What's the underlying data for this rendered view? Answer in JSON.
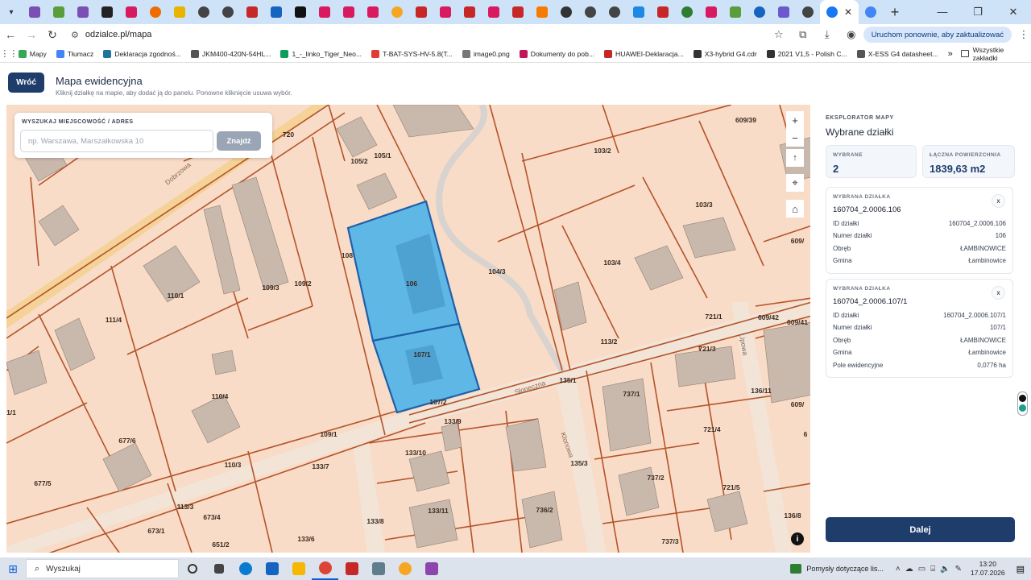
{
  "browser": {
    "url": "odzialce.pl/mapa",
    "update_label": "Uruchom ponownie, aby zaktualizować",
    "bookmarks": [
      {
        "label": "Mapy",
        "color": "#34a853"
      },
      {
        "label": "Tłumacz",
        "color": "#4285f4"
      },
      {
        "label": "Deklaracja zgodnoś...",
        "color": "#21759b"
      },
      {
        "label": "JKM400-420N-54HL...",
        "color": "#555555"
      },
      {
        "label": "1_-_linko_Tiger_Neo...",
        "color": "#0f9d58"
      },
      {
        "label": "T-BAT-SYS-HV-5.8(T...",
        "color": "#e53935"
      },
      {
        "label": "image0.png",
        "color": "#777777"
      },
      {
        "label": "Dokumenty do pob...",
        "color": "#c2185b"
      },
      {
        "label": "HUAWEI-Deklaracja...",
        "color": "#c62828"
      },
      {
        "label": "X3-hybrid G4.cdr",
        "color": "#333333"
      },
      {
        "label": "2021 V1,5 - Polish C...",
        "color": "#333333"
      },
      {
        "label": "X-ESS G4 datasheet...",
        "color": "#555555"
      }
    ],
    "all_bookmarks_label": "Wszystkie zakładki"
  },
  "header": {
    "back_label": "Wróć",
    "title": "Mapa ewidencyjna",
    "subtitle": "Kliknij działkę na mapie, aby dodać ją do panelu. Ponowne kliknięcie usuwa wybór."
  },
  "search": {
    "label": "WYSZUKAJ MIEJSCOWOŚĆ / ADRES",
    "placeholder": "np. Warszawa, Marszałkowska 10",
    "button": "Znajdź"
  },
  "map": {
    "parcel_labels": [
      {
        "text": "720"
      },
      {
        "text": "105/1"
      },
      {
        "text": "105/2"
      },
      {
        "text": "108"
      },
      {
        "text": "106"
      },
      {
        "text": "107/1"
      },
      {
        "text": "107/2"
      },
      {
        "text": "109/3"
      },
      {
        "text": "109/2"
      },
      {
        "text": "110/1"
      },
      {
        "text": "111/4"
      },
      {
        "text": "110/4"
      },
      {
        "text": "104/3"
      },
      {
        "text": "103/2"
      },
      {
        "text": "103/3"
      },
      {
        "text": "103/4"
      },
      {
        "text": "609/39"
      },
      {
        "text": "609/"
      },
      {
        "text": "609/42"
      },
      {
        "text": "609/41"
      },
      {
        "text": "113/2"
      },
      {
        "text": "135/1"
      },
      {
        "text": "133/9"
      },
      {
        "text": "109/1"
      },
      {
        "text": "110/3"
      },
      {
        "text": "677/6"
      },
      {
        "text": "677/5"
      },
      {
        "text": "133/7"
      },
      {
        "text": "133/10"
      },
      {
        "text": "133/11"
      },
      {
        "text": "133/8"
      },
      {
        "text": "133/6"
      },
      {
        "text": "113/3"
      },
      {
        "text": "673/4"
      },
      {
        "text": "673/1"
      },
      {
        "text": "651/2"
      },
      {
        "text": "135/3"
      },
      {
        "text": "736/2"
      },
      {
        "text": "737/1"
      },
      {
        "text": "737/2"
      },
      {
        "text": "737/3"
      },
      {
        "text": "721/1"
      },
      {
        "text": "721/3"
      },
      {
        "text": "721/4"
      },
      {
        "text": "721/5"
      },
      {
        "text": "136/11"
      },
      {
        "text": "136/8"
      },
      {
        "text": "609/"
      },
      {
        "text": "1/1"
      },
      {
        "text": "6"
      }
    ],
    "street_labels": [
      {
        "text": "Dobrzowa"
      },
      {
        "text": "Słoneczna"
      },
      {
        "text": "Klonowa"
      },
      {
        "text": "Lipowa"
      }
    ],
    "selected_color": "#5fb7e6",
    "parcel_fill": "#f8dcc7",
    "parcel_line": "#b5532a"
  },
  "panel": {
    "kicker": "EKSPLORATOR MAPY",
    "title": "Wybrane działki",
    "selected_label": "WYBRANE",
    "selected_value": "2",
    "area_label": "ŁĄCZNA POWIERZCHNIA",
    "area_value": "1839,63 m2",
    "cards": [
      {
        "kicker": "WYBRANA DZIAŁKA",
        "name": "160704_2.0006.106",
        "rows": [
          {
            "label": "ID działki",
            "value": "160704_2.0006.106"
          },
          {
            "label": "Numer działki",
            "value": "106"
          },
          {
            "label": "Obręb",
            "value": "ŁAMBINOWICE"
          },
          {
            "label": "Gmina",
            "value": "Łambinowice"
          }
        ]
      },
      {
        "kicker": "WYBRANA DZIAŁKA",
        "name": "160704_2.0006.107/1",
        "rows": [
          {
            "label": "ID działki",
            "value": "160704_2.0006.107/1"
          },
          {
            "label": "Numer działki",
            "value": "107/1"
          },
          {
            "label": "Obręb",
            "value": "ŁAMBINOWICE"
          },
          {
            "label": "Gmina",
            "value": "Łambinowice"
          },
          {
            "label": "Pole ewidencyjne",
            "value": "0,0776 ha"
          }
        ]
      }
    ],
    "next_label": "Dalej"
  },
  "taskbar": {
    "search_placeholder": "Wyszukaj",
    "weather_label": "Pomysły dotyczące lis...",
    "time": "13:20",
    "date": "17.07.2026"
  }
}
